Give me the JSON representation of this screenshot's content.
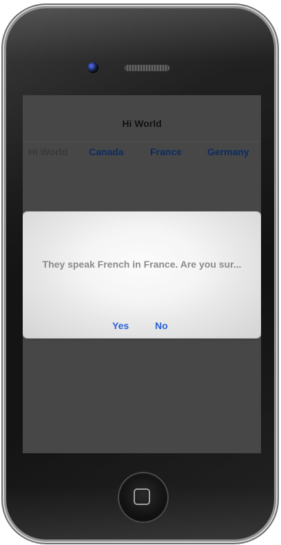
{
  "device": {
    "screen": {
      "nav_title": "Hi World",
      "tabs": [
        {
          "label": "Hi World"
        },
        {
          "label": "Canada"
        },
        {
          "label": "France"
        },
        {
          "label": "Germany"
        }
      ],
      "alert": {
        "message": "They speak French in France.  Are you sur...",
        "buttons": {
          "yes": "Yes",
          "no": "No"
        }
      }
    },
    "icons": {
      "camera": "camera-icon",
      "speaker": "speaker-icon",
      "home": "home-button-icon"
    },
    "colors": {
      "screen_background": "#474747",
      "alert_button": "#2962d7",
      "tab_selected": "#393939",
      "tab_unselected": "#0d2b61"
    }
  }
}
